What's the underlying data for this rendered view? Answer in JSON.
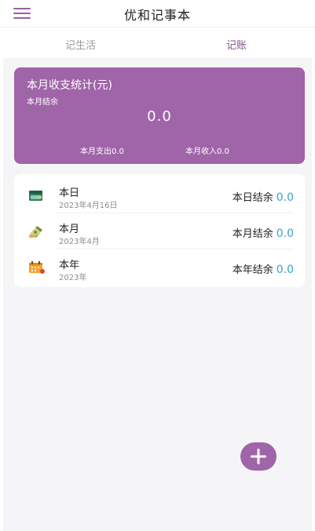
{
  "header": {
    "title": "优和记事本",
    "menu_icon": "hamburger-menu-icon"
  },
  "tabs": [
    {
      "label": "记生活",
      "active": false
    },
    {
      "label": "记账",
      "active": true
    }
  ],
  "stats": {
    "title": "本月收支统计(元)",
    "subtitle": "本月结余",
    "balance": "0.0",
    "expense": "本月支出0.0",
    "income": "本月收入0.0"
  },
  "rows": [
    {
      "name": "本日",
      "date": "2023年4月16日",
      "balance_label": "本日结余",
      "balance_value": "0.0",
      "icon": "wallet-icon"
    },
    {
      "name": "本月",
      "date": "2023年4月",
      "balance_label": "本月结余",
      "balance_value": "0.0",
      "icon": "money-notes-icon"
    },
    {
      "name": "本年",
      "date": "2023年",
      "balance_label": "本年结余",
      "balance_value": "0.0",
      "icon": "calendar-icon"
    }
  ],
  "fab": {
    "icon": "plus-icon"
  },
  "colors": {
    "accent": "#a064a8",
    "tab_active": "#8a4e93",
    "value": "#3aa3c4",
    "background": "#f5f5f7"
  }
}
